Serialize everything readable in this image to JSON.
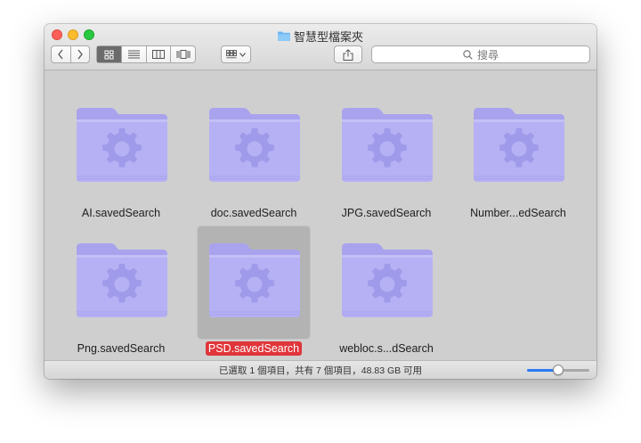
{
  "window": {
    "title": "智慧型檔案夾"
  },
  "toolbar": {
    "search_placeholder": "搜尋",
    "view_modes": [
      "icon-view",
      "list-view",
      "column-view",
      "gallery-view"
    ],
    "active_view": 0
  },
  "items": [
    {
      "label": "AI.savedSearch",
      "selected": false
    },
    {
      "label": "doc.savedSearch",
      "selected": false
    },
    {
      "label": "JPG.savedSearch",
      "selected": false
    },
    {
      "label": "Number...edSearch",
      "selected": false
    },
    {
      "label": "Png.savedSearch",
      "selected": false
    },
    {
      "label": "PSD.savedSearch",
      "selected": true
    },
    {
      "label": "webloc.s...dSearch",
      "selected": false
    }
  ],
  "statusbar": {
    "text": "已選取 1 個項目，共有 7 個項目，48.83 GB 可用",
    "icon_size_level": 0.5
  },
  "colors": {
    "folder_body": "#b3aef2",
    "folder_tab": "#a9a3ee",
    "gear": "#9d98e8",
    "selection_label": "#e0353a",
    "slider_fill": "#2a7bf4"
  }
}
